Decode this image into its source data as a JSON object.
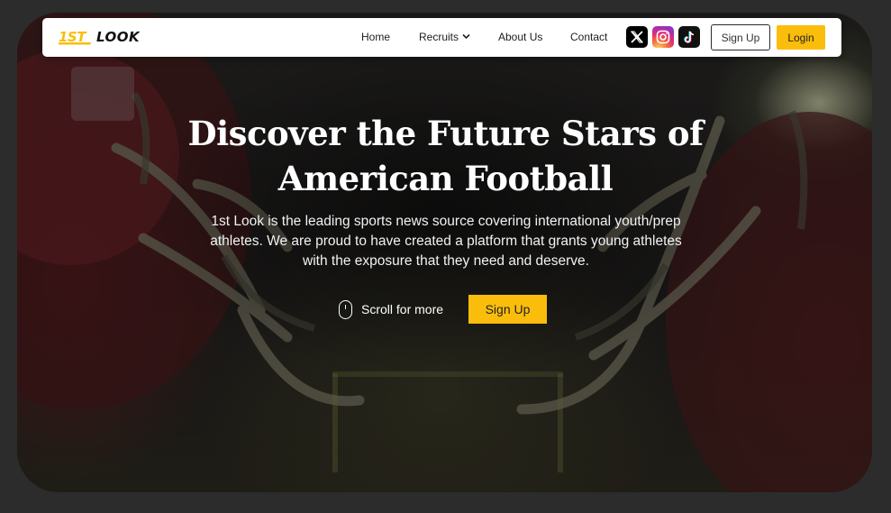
{
  "brand": {
    "logo_text": "1ST LOOK",
    "accent_color": "#fbbd0b"
  },
  "nav": {
    "links": [
      {
        "label": "Home"
      },
      {
        "label": "Recruits",
        "has_dropdown": true
      },
      {
        "label": "About Us"
      },
      {
        "label": "Contact"
      }
    ],
    "social_icons": [
      "x-icon",
      "instagram-icon",
      "tiktok-icon"
    ],
    "signup_label": "Sign Up",
    "login_label": "Login"
  },
  "hero": {
    "headline_line1": "Discover the Future Stars of",
    "headline_line2": "American Football",
    "description_line1": "1st Look is the leading sports news source covering international youth/prep",
    "description_line2": "athletes. We are proud to have created a platform that grants young athletes",
    "description_line3": "with the exposure that they need and deserve.",
    "scroll_label": "Scroll for more",
    "cta_label": "Sign Up"
  }
}
